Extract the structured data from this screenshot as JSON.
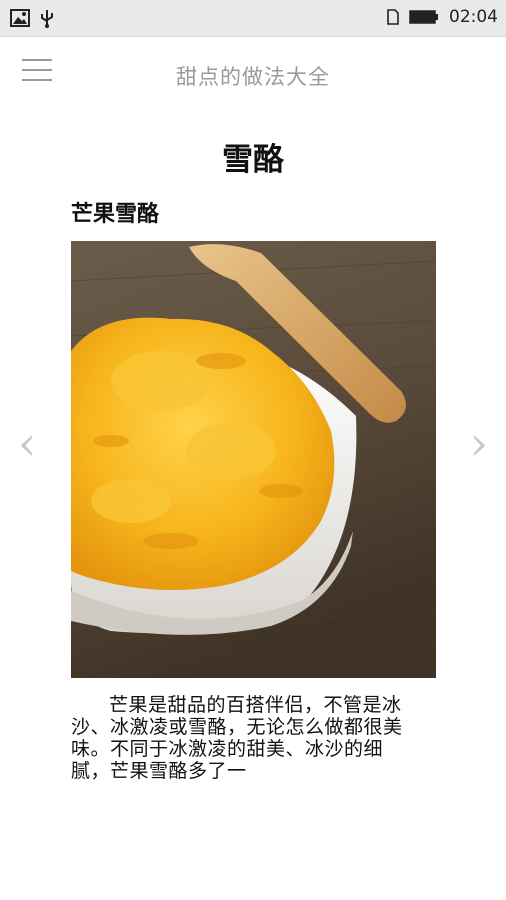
{
  "status_bar": {
    "icons": [
      "image-icon",
      "usb-icon",
      "sim-icon",
      "battery-icon"
    ],
    "time": "02:04"
  },
  "app_bar": {
    "menu_icon": "hamburger-menu-icon",
    "title": "甜点的做法大全"
  },
  "page": {
    "title": "雪酪",
    "recipe_title": "芒果雪酪",
    "photo_subject": "mango sorbet in a white bowl with a wooden spoon",
    "prev_arrow": "‹",
    "next_arrow": "›",
    "description": "芒果是甜品的百搭伴侣，不管是冰沙、冰激凌或雪酪，无论怎么做都很美味。不同于冰激凌的甜美、冰沙的细腻，芒果雪酪多了一"
  },
  "colors": {
    "status_bar_bg": "#e9e9e9",
    "muted_text": "#9a9a9a",
    "sorbet": "#f6b51e",
    "table_wood": "#5a4a3a"
  }
}
